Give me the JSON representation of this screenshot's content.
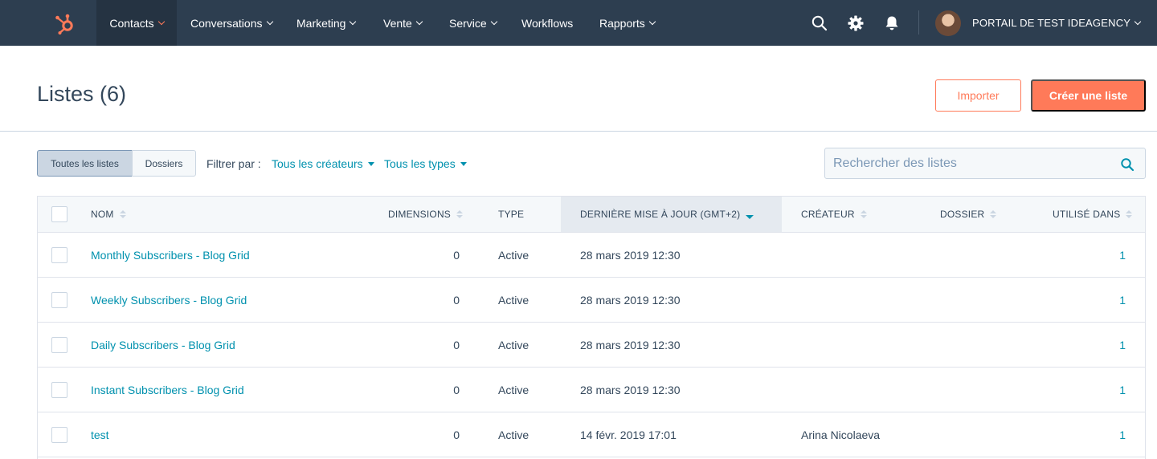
{
  "nav": {
    "logo_icon": "hubspot-sprocket-icon",
    "items": [
      {
        "label": "Contacts",
        "active": true
      },
      {
        "label": "Conversations"
      },
      {
        "label": "Marketing"
      },
      {
        "label": "Vente"
      },
      {
        "label": "Service"
      },
      {
        "label": "Workflows"
      },
      {
        "label": "Rapports"
      }
    ],
    "portal_name": "PORTAIL DE TEST IDEAGENCY"
  },
  "header": {
    "title": "Listes (6)",
    "import_label": "Importer",
    "create_label": "Créer une liste"
  },
  "filters": {
    "segment_all": "Toutes les listes",
    "segment_folders": "Dossiers",
    "filter_label": "Filtrer par :",
    "creators": "Tous les créateurs",
    "types": "Tous les types",
    "search_placeholder": "Rechercher des listes"
  },
  "table": {
    "columns": {
      "name": "NOM",
      "dimensions": "DIMENSIONS",
      "type": "TYPE",
      "updated": "DERNIÈRE MISE À JOUR (GMT+2)",
      "creator": "CRÉATEUR",
      "folder": "DOSSIER",
      "used_in": "UTILISÉ DANS"
    },
    "rows": [
      {
        "name": "Monthly Subscribers - Blog Grid",
        "dimensions": "0",
        "type": "Active",
        "updated": "28 mars 2019 12:30",
        "creator": "",
        "folder": "",
        "used_in": "1"
      },
      {
        "name": "Weekly Subscribers - Blog Grid",
        "dimensions": "0",
        "type": "Active",
        "updated": "28 mars 2019 12:30",
        "creator": "",
        "folder": "",
        "used_in": "1"
      },
      {
        "name": "Daily Subscribers - Blog Grid",
        "dimensions": "0",
        "type": "Active",
        "updated": "28 mars 2019 12:30",
        "creator": "",
        "folder": "",
        "used_in": "1"
      },
      {
        "name": "Instant Subscribers - Blog Grid",
        "dimensions": "0",
        "type": "Active",
        "updated": "28 mars 2019 12:30",
        "creator": "",
        "folder": "",
        "used_in": "1"
      },
      {
        "name": "test",
        "dimensions": "0",
        "type": "Active",
        "updated": "14 févr. 2019 17:01",
        "creator": "Arina Nicolaeva",
        "folder": "",
        "used_in": "1"
      }
    ]
  },
  "colors": {
    "nav_bg": "#2d3e50",
    "accent": "#ff7a59",
    "link": "#0091ae",
    "text": "#33475b"
  }
}
